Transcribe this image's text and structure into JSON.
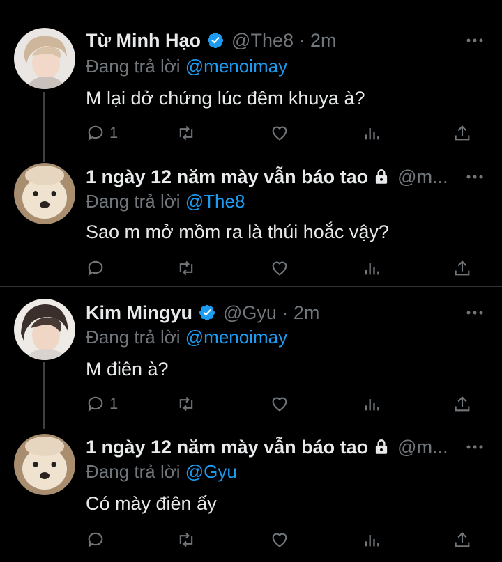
{
  "colors": {
    "background": "#000000",
    "text": "#e7e9ea",
    "muted": "#71767b",
    "link": "#1d9bf0",
    "divider": "#2f3336"
  },
  "tweets": [
    {
      "name": "Từ Minh Hạo",
      "verified": true,
      "handle": "@The8 · 2m",
      "reply_prefix": "Đang trả lời ",
      "reply_to": "@menoimay",
      "text": "M lại dở chứng lúc đêm khuya à?",
      "reply_count": "1",
      "avatar_icon": "avatar-icon"
    },
    {
      "name": "1 ngày 12 năm mày vẫn báo tao",
      "locked": true,
      "handle": "@m...",
      "reply_prefix": "Đang trả lời ",
      "reply_to": "@The8",
      "text": "Sao m mở mồm ra là thúi hoắc vậy?",
      "reply_count": "",
      "avatar_icon": "avatar-icon"
    },
    {
      "name": "Kim Mingyu",
      "verified": true,
      "handle": "@Gyu · 2m",
      "reply_prefix": "Đang trả lời ",
      "reply_to": "@menoimay",
      "text": "M điên à?",
      "reply_count": "1",
      "avatar_icon": "avatar-icon"
    },
    {
      "name": "1 ngày 12 năm mày vẫn báo tao",
      "locked": true,
      "handle": "@m...",
      "reply_prefix": "Đang trả lời ",
      "reply_to": "@Gyu",
      "text": "Có mày điên ấy",
      "reply_count": "",
      "avatar_icon": "avatar-icon"
    }
  ],
  "action_icons": [
    "reply-icon",
    "retweet-icon",
    "like-icon",
    "views-icon",
    "share-icon"
  ]
}
